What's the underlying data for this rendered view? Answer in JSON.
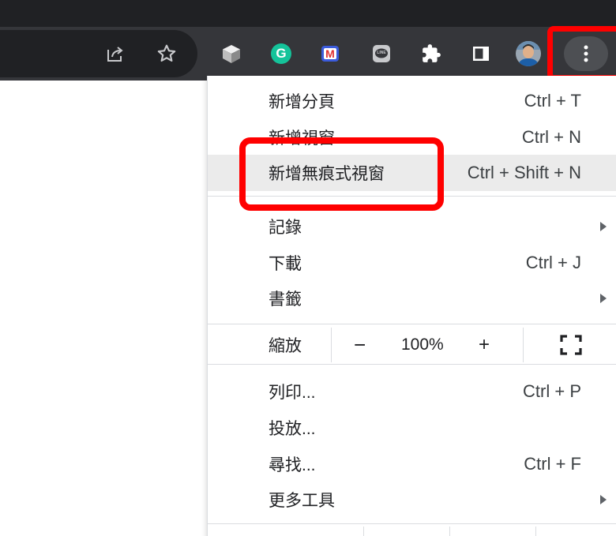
{
  "toolbar": {
    "icons": [
      "share-icon",
      "bookmark-star-icon",
      "cube-extension-icon",
      "grammarly-extension-icon",
      "mail-extension-icon",
      "line-extension-icon",
      "extensions-puzzle-icon",
      "side-panel-icon",
      "profile-avatar",
      "more-menu-icon"
    ],
    "grammarly_letter": "G",
    "mail_letter": "M",
    "line_text": "LINE"
  },
  "menu": {
    "new_tab": {
      "label": "新增分頁",
      "shortcut": "Ctrl + T"
    },
    "new_window": {
      "label": "新增視窗",
      "shortcut": "Ctrl + N"
    },
    "new_incognito": {
      "label": "新增無痕式視窗",
      "shortcut": "Ctrl + Shift + N"
    },
    "history": {
      "label": "記錄"
    },
    "downloads": {
      "label": "下載",
      "shortcut": "Ctrl + J"
    },
    "bookmarks": {
      "label": "書籤"
    },
    "zoom": {
      "label": "縮放",
      "minus": "−",
      "value": "100%",
      "plus": "+"
    },
    "print": {
      "label": "列印...",
      "shortcut": "Ctrl + P"
    },
    "cast": {
      "label": "投放..."
    },
    "find": {
      "label": "尋找...",
      "shortcut": "Ctrl + F"
    },
    "more_tools": {
      "label": "更多工具"
    }
  },
  "colors": {
    "highlight": "#ff0000",
    "toolbar_bg": "#35363a",
    "grammarly": "#15c39a",
    "mail": "#3b5bdb"
  }
}
